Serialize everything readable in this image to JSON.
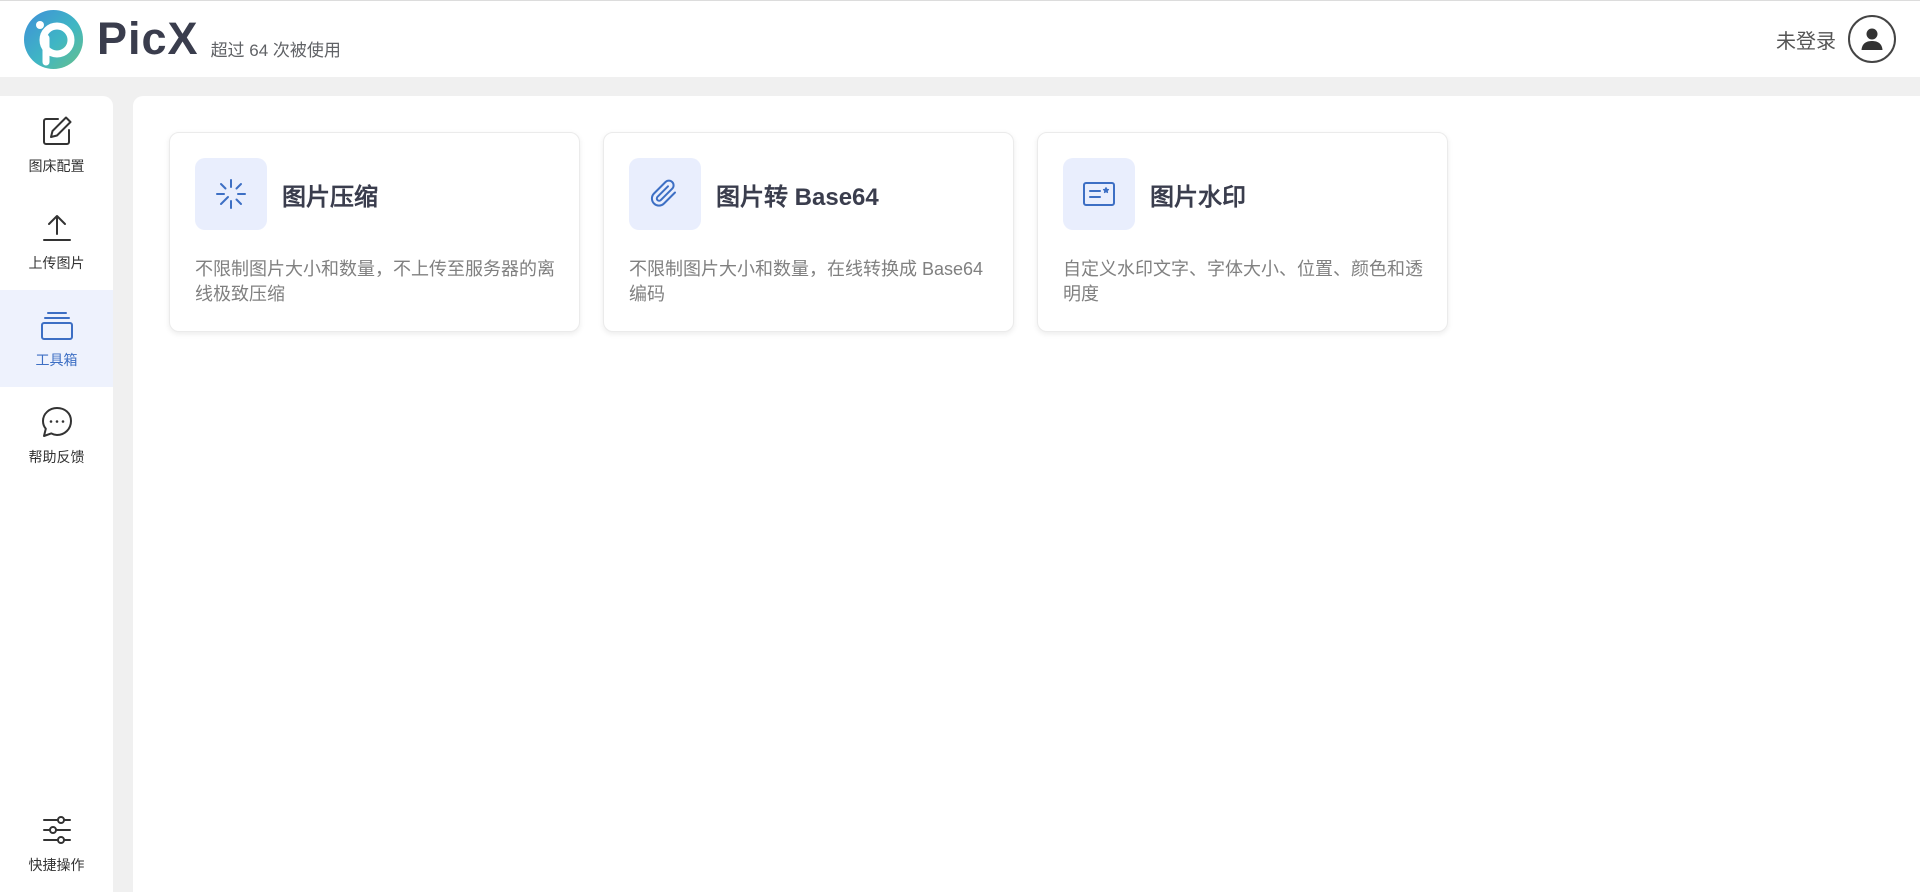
{
  "header": {
    "brand_name": "PicX",
    "brand_sub": "超过 64 次被使用",
    "user_label": "未登录"
  },
  "sidebar": {
    "items": [
      {
        "label": "图床配置",
        "icon": "edit-icon"
      },
      {
        "label": "上传图片",
        "icon": "upload-icon"
      },
      {
        "label": "工具箱",
        "icon": "toolbox-icon",
        "active": true
      },
      {
        "label": "帮助反馈",
        "icon": "chat-icon"
      }
    ],
    "bottom": {
      "label": "快捷操作",
      "icon": "sliders-icon"
    }
  },
  "tools": [
    {
      "title": "图片压缩",
      "desc": "不限制图片大小和数量，不上传至服务器的离线极致压缩",
      "icon": "compress-icon"
    },
    {
      "title": "图片转 Base64",
      "desc": "不限制图片大小和数量，在线转换成 Base64 编码",
      "icon": "paperclip-icon"
    },
    {
      "title": "图片水印",
      "desc": "自定义水印文字、字体大小、位置、颜色和透明度",
      "icon": "watermark-icon"
    }
  ],
  "colors": {
    "accent": "#3d6fc4",
    "active_bg": "#eef2fd",
    "icon_bg": "#e9eefd",
    "page_bg": "#f0f0f0"
  }
}
